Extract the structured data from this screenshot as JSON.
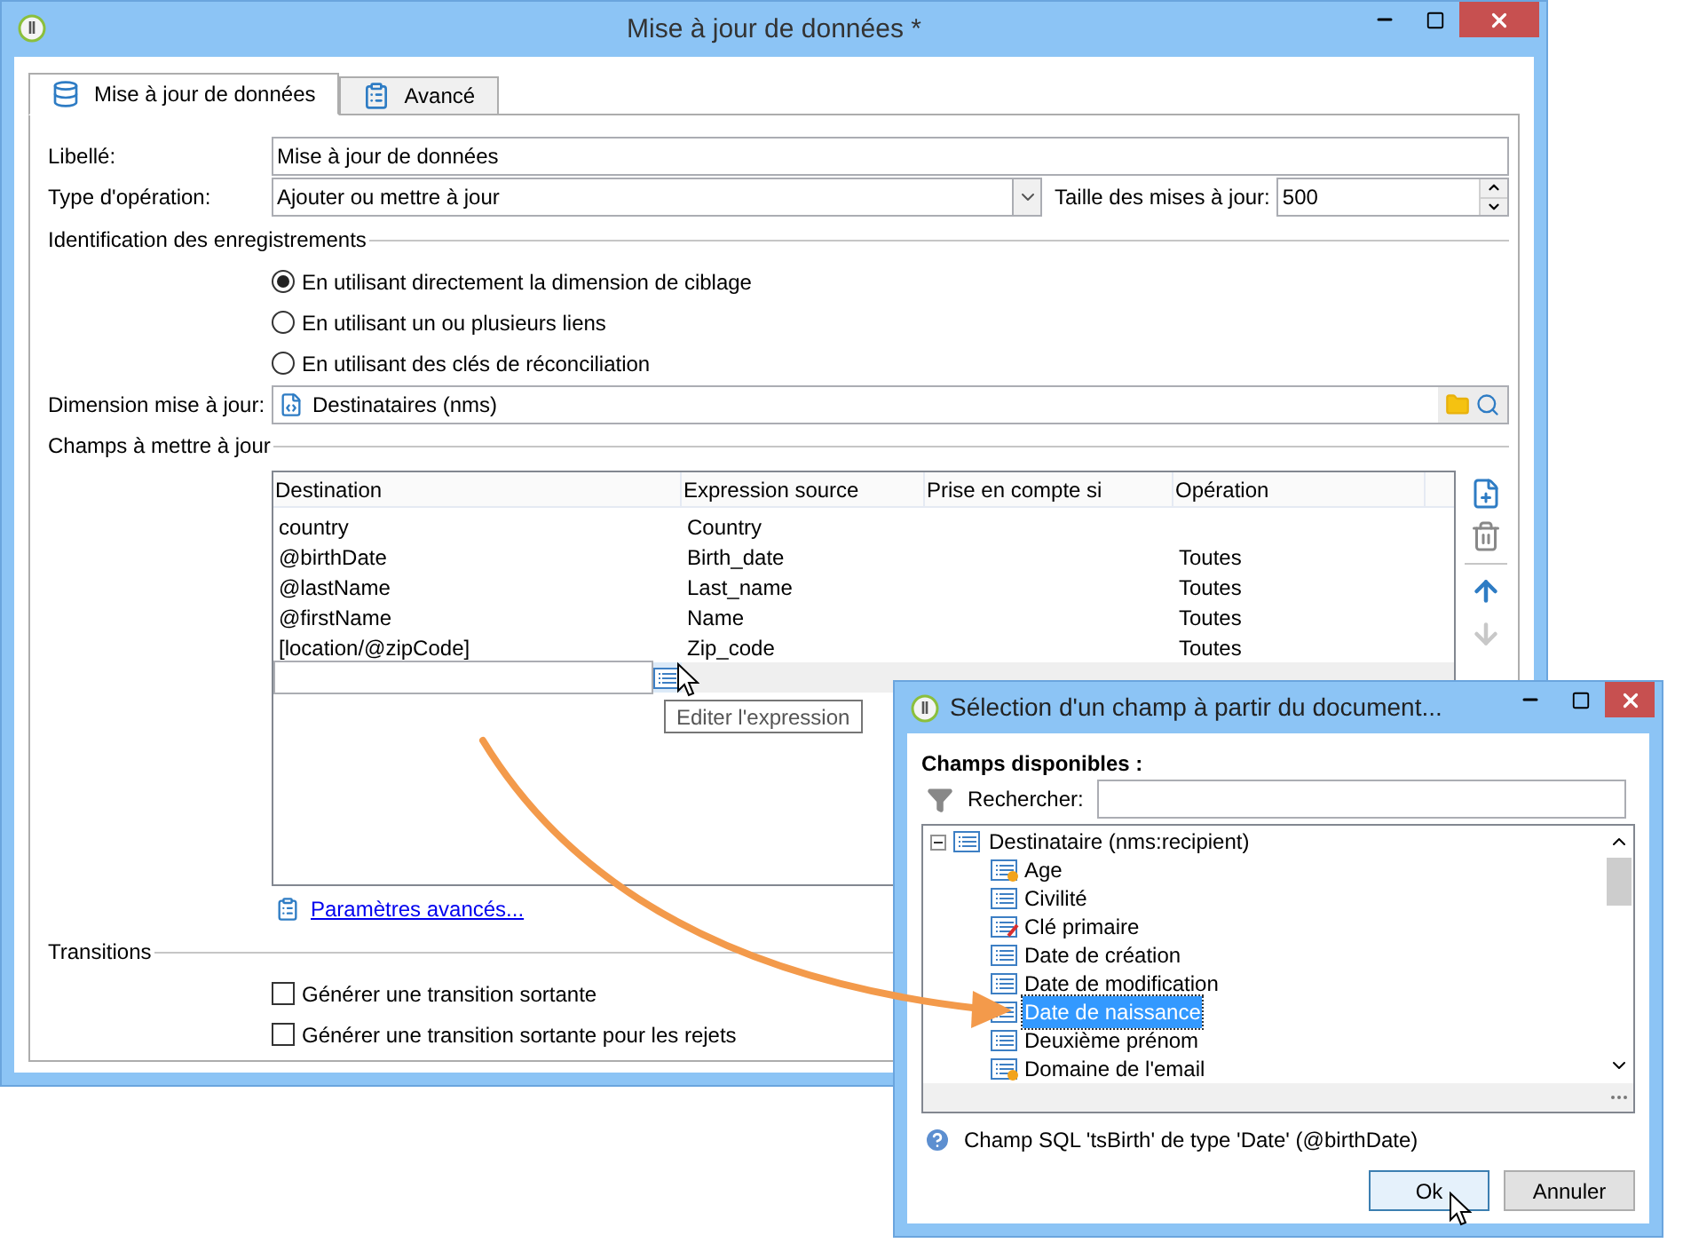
{
  "main_window": {
    "title": "Mise à jour de données *",
    "tabs": [
      {
        "label": "Mise à jour de données",
        "selected": true
      },
      {
        "label": "Avancé",
        "selected": false
      }
    ],
    "label_field": {
      "label": "Libellé:",
      "value": "Mise à jour de données"
    },
    "operation_type": {
      "label": "Type d'opération:",
      "value": "Ajouter ou mettre à jour"
    },
    "update_size": {
      "label": "Taille des mises à jour:",
      "value": "500"
    },
    "identification": {
      "heading": "Identification des enregistrements",
      "options": [
        {
          "label": "En utilisant directement la dimension de ciblage",
          "selected": true
        },
        {
          "label": "En utilisant un ou plusieurs liens",
          "selected": false
        },
        {
          "label": "En utilisant des clés de réconciliation",
          "selected": false
        }
      ]
    },
    "dimension": {
      "label": "Dimension mise à jour:",
      "value": "Destinataires (nms)"
    },
    "fields_section": {
      "heading": "Champs à mettre à jour",
      "table": {
        "columns": [
          "Destination",
          "Expression source",
          "Prise en compte si",
          "Opération"
        ],
        "rows": [
          {
            "editing": false,
            "destination": "country",
            "source": "Country"
          },
          {
            "editing": false,
            "destination": "@birthDate",
            "source": "Birth_date",
            "operation": "Toutes"
          },
          {
            "editing": false,
            "destination": "@lastName",
            "source": "Last_name",
            "operation": "Toutes"
          },
          {
            "editing": false,
            "destination": "@firstName",
            "source": "Name",
            "operation": "Toutes"
          },
          {
            "editing": false,
            "destination": "[location/@zipCode]",
            "source": "Zip_code",
            "operation": "Toutes"
          },
          {
            "editing": true
          }
        ]
      }
    },
    "advanced_link": "Paramètres avancés...",
    "transitions": {
      "heading": "Transitions",
      "options": [
        {
          "label": "Générer une transition sortante",
          "checked": false
        },
        {
          "label": "Générer une transition sortante pour les rejets",
          "checked": false
        }
      ]
    }
  },
  "tooltip": "Editer l'expression",
  "dialog": {
    "title": "Sélection d'un champ à partir du document...",
    "available_heading": "Champs disponibles :",
    "search": {
      "label": "Rechercher:"
    },
    "tree": {
      "label": "Destinataire (nms:recipient)",
      "expanded": true,
      "children": [
        {
          "label": "Age",
          "kind": "computed",
          "selected": false
        },
        {
          "label": "Civilité",
          "kind": "field",
          "selected": false
        },
        {
          "label": "Clé primaire",
          "kind": "key",
          "selected": false
        },
        {
          "label": "Date de création",
          "kind": "field",
          "selected": false
        },
        {
          "label": "Date de modification",
          "kind": "field",
          "selected": false
        },
        {
          "label": "Date de naissance",
          "kind": "field",
          "selected": true
        },
        {
          "label": "Deuxième prénom",
          "kind": "field",
          "selected": false
        },
        {
          "label": "Domaine de l'email",
          "kind": "computed",
          "selected": false
        }
      ]
    },
    "info": "Champ SQL 'tsBirth' de type 'Date' (@birthDate)",
    "buttons": [
      {
        "label": "Ok",
        "default": true
      },
      {
        "label": "Annuler",
        "default": false
      }
    ]
  }
}
